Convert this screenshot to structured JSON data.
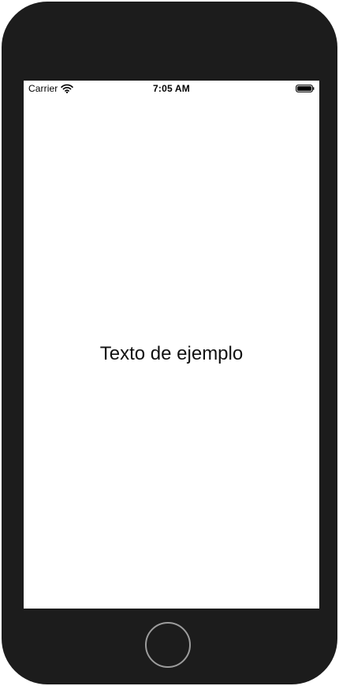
{
  "status_bar": {
    "carrier": "Carrier",
    "time": "7:05 AM",
    "icons": [
      "wifi-icon",
      "battery-icon"
    ]
  },
  "main": {
    "label": "Texto de ejemplo"
  },
  "colors": {
    "device_frame": "#1c1c1c",
    "screen_background": "#ffffff",
    "text": "#111111",
    "home_button_border": "#9c9c9c"
  }
}
